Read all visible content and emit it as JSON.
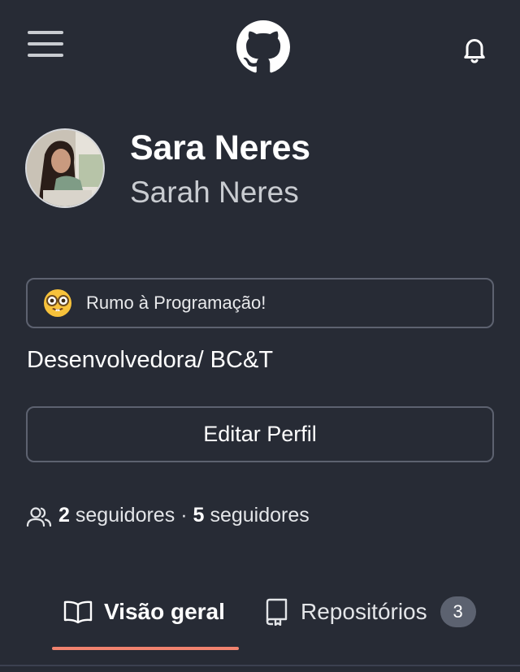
{
  "header": {
    "menu_icon": "hamburger-menu-icon",
    "logo_icon": "github-octocat-icon",
    "notification_icon": "bell-icon"
  },
  "profile": {
    "display_name": "Sara Neres",
    "username": "Sarah Neres",
    "status": {
      "emoji_icon": "nerd-face-emoji",
      "text": "Rumo à Programação!"
    },
    "bio": "Desenvolvedora/ BC&T",
    "edit_button_label": "Editar Perfil",
    "followers": {
      "icon": "people-icon",
      "followers_count": "2",
      "followers_label": "seguidores",
      "separator": "·",
      "following_count": "5",
      "following_label": "seguidores"
    }
  },
  "tabs": [
    {
      "label": "Visão geral",
      "icon": "book-icon",
      "active": true
    },
    {
      "label": "Repositórios",
      "icon": "repo-icon",
      "count": "3",
      "active": false
    }
  ],
  "colors": {
    "background": "#272b35",
    "border": "#5d6270",
    "active_tab_underline": "#f1836f",
    "counter_badge": "#5c6270"
  }
}
